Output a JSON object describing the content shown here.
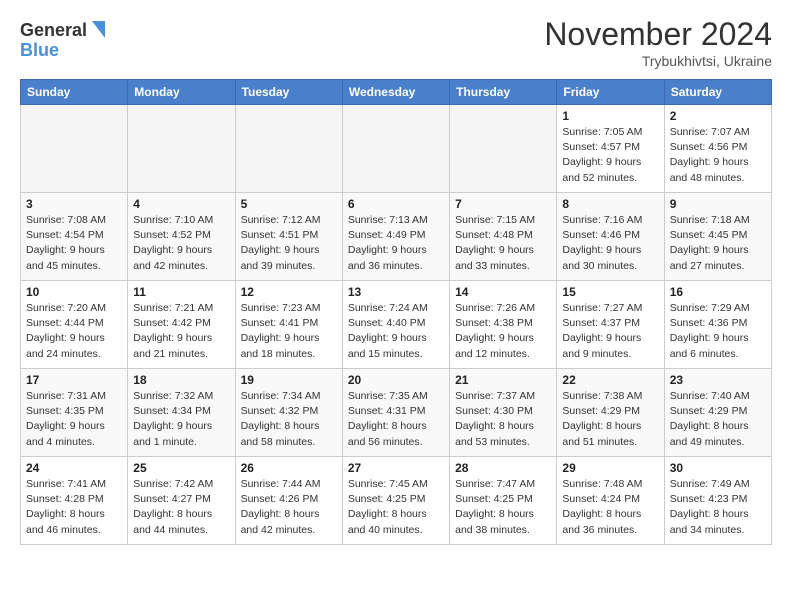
{
  "logo": {
    "line1": "General",
    "line2": "Blue"
  },
  "header": {
    "month": "November 2024",
    "location": "Trybukhivtsi, Ukraine"
  },
  "weekdays": [
    "Sunday",
    "Monday",
    "Tuesday",
    "Wednesday",
    "Thursday",
    "Friday",
    "Saturday"
  ],
  "weeks": [
    [
      {
        "day": "",
        "info": ""
      },
      {
        "day": "",
        "info": ""
      },
      {
        "day": "",
        "info": ""
      },
      {
        "day": "",
        "info": ""
      },
      {
        "day": "",
        "info": ""
      },
      {
        "day": "1",
        "info": "Sunrise: 7:05 AM\nSunset: 4:57 PM\nDaylight: 9 hours\nand 52 minutes."
      },
      {
        "day": "2",
        "info": "Sunrise: 7:07 AM\nSunset: 4:56 PM\nDaylight: 9 hours\nand 48 minutes."
      }
    ],
    [
      {
        "day": "3",
        "info": "Sunrise: 7:08 AM\nSunset: 4:54 PM\nDaylight: 9 hours\nand 45 minutes."
      },
      {
        "day": "4",
        "info": "Sunrise: 7:10 AM\nSunset: 4:52 PM\nDaylight: 9 hours\nand 42 minutes."
      },
      {
        "day": "5",
        "info": "Sunrise: 7:12 AM\nSunset: 4:51 PM\nDaylight: 9 hours\nand 39 minutes."
      },
      {
        "day": "6",
        "info": "Sunrise: 7:13 AM\nSunset: 4:49 PM\nDaylight: 9 hours\nand 36 minutes."
      },
      {
        "day": "7",
        "info": "Sunrise: 7:15 AM\nSunset: 4:48 PM\nDaylight: 9 hours\nand 33 minutes."
      },
      {
        "day": "8",
        "info": "Sunrise: 7:16 AM\nSunset: 4:46 PM\nDaylight: 9 hours\nand 30 minutes."
      },
      {
        "day": "9",
        "info": "Sunrise: 7:18 AM\nSunset: 4:45 PM\nDaylight: 9 hours\nand 27 minutes."
      }
    ],
    [
      {
        "day": "10",
        "info": "Sunrise: 7:20 AM\nSunset: 4:44 PM\nDaylight: 9 hours\nand 24 minutes."
      },
      {
        "day": "11",
        "info": "Sunrise: 7:21 AM\nSunset: 4:42 PM\nDaylight: 9 hours\nand 21 minutes."
      },
      {
        "day": "12",
        "info": "Sunrise: 7:23 AM\nSunset: 4:41 PM\nDaylight: 9 hours\nand 18 minutes."
      },
      {
        "day": "13",
        "info": "Sunrise: 7:24 AM\nSunset: 4:40 PM\nDaylight: 9 hours\nand 15 minutes."
      },
      {
        "day": "14",
        "info": "Sunrise: 7:26 AM\nSunset: 4:38 PM\nDaylight: 9 hours\nand 12 minutes."
      },
      {
        "day": "15",
        "info": "Sunrise: 7:27 AM\nSunset: 4:37 PM\nDaylight: 9 hours\nand 9 minutes."
      },
      {
        "day": "16",
        "info": "Sunrise: 7:29 AM\nSunset: 4:36 PM\nDaylight: 9 hours\nand 6 minutes."
      }
    ],
    [
      {
        "day": "17",
        "info": "Sunrise: 7:31 AM\nSunset: 4:35 PM\nDaylight: 9 hours\nand 4 minutes."
      },
      {
        "day": "18",
        "info": "Sunrise: 7:32 AM\nSunset: 4:34 PM\nDaylight: 9 hours\nand 1 minute."
      },
      {
        "day": "19",
        "info": "Sunrise: 7:34 AM\nSunset: 4:32 PM\nDaylight: 8 hours\nand 58 minutes."
      },
      {
        "day": "20",
        "info": "Sunrise: 7:35 AM\nSunset: 4:31 PM\nDaylight: 8 hours\nand 56 minutes."
      },
      {
        "day": "21",
        "info": "Sunrise: 7:37 AM\nSunset: 4:30 PM\nDaylight: 8 hours\nand 53 minutes."
      },
      {
        "day": "22",
        "info": "Sunrise: 7:38 AM\nSunset: 4:29 PM\nDaylight: 8 hours\nand 51 minutes."
      },
      {
        "day": "23",
        "info": "Sunrise: 7:40 AM\nSunset: 4:29 PM\nDaylight: 8 hours\nand 49 minutes."
      }
    ],
    [
      {
        "day": "24",
        "info": "Sunrise: 7:41 AM\nSunset: 4:28 PM\nDaylight: 8 hours\nand 46 minutes."
      },
      {
        "day": "25",
        "info": "Sunrise: 7:42 AM\nSunset: 4:27 PM\nDaylight: 8 hours\nand 44 minutes."
      },
      {
        "day": "26",
        "info": "Sunrise: 7:44 AM\nSunset: 4:26 PM\nDaylight: 8 hours\nand 42 minutes."
      },
      {
        "day": "27",
        "info": "Sunrise: 7:45 AM\nSunset: 4:25 PM\nDaylight: 8 hours\nand 40 minutes."
      },
      {
        "day": "28",
        "info": "Sunrise: 7:47 AM\nSunset: 4:25 PM\nDaylight: 8 hours\nand 38 minutes."
      },
      {
        "day": "29",
        "info": "Sunrise: 7:48 AM\nSunset: 4:24 PM\nDaylight: 8 hours\nand 36 minutes."
      },
      {
        "day": "30",
        "info": "Sunrise: 7:49 AM\nSunset: 4:23 PM\nDaylight: 8 hours\nand 34 minutes."
      }
    ]
  ]
}
